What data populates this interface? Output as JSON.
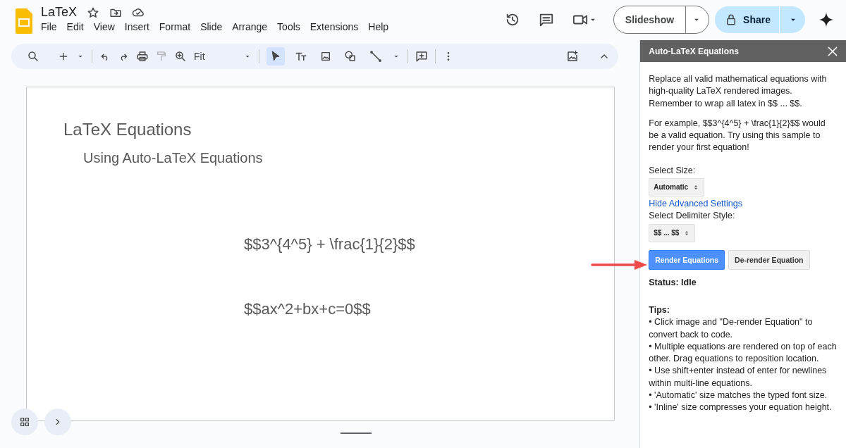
{
  "document": {
    "title": "LaTeX",
    "menu": [
      "File",
      "Edit",
      "View",
      "Insert",
      "Format",
      "Slide",
      "Arrange",
      "Tools",
      "Extensions",
      "Help"
    ]
  },
  "header_buttons": {
    "slideshow": "Slideshow",
    "share": "Share"
  },
  "toolbar": {
    "zoom": "Fit",
    "tools": [
      {
        "kind": "select",
        "selected": true
      },
      {
        "kind": "text",
        "selected": false
      },
      {
        "kind": "image",
        "selected": false
      },
      {
        "kind": "shape",
        "selected": false
      },
      {
        "kind": "line",
        "selected": false
      }
    ]
  },
  "slide": {
    "title": "LaTeX Equations",
    "subtitle": "Using Auto-LaTeX Equations",
    "equations": [
      "$$3^{4^5} + \\frac{1}{2}$$",
      "$$ax^2+bx+c=0$$"
    ]
  },
  "sidebar": {
    "title": "Auto-LaTeX Equations",
    "paragraphs": [
      "Replace all valid mathematical equations with high-quality LaTeX rendered images. Remember to wrap all latex in $$ ... $$.",
      "For example, $$3^{4^5} + \\frac{1}{2}$$ would be a valid equation. Try using this sample to render your first equation!"
    ],
    "size_label": "Select Size:",
    "size_value": "Automatic",
    "advanced_link": "Hide Advanced Settings",
    "delimiter_label": "Select Delimiter Style:",
    "delimiter_value": "$$ ... $$",
    "buttons": [
      {
        "label": "Render Equations",
        "kind": "primary"
      },
      {
        "label": "De-render Equation",
        "kind": "secondary"
      }
    ],
    "status": "Status: Idle",
    "tips_title": "Tips:",
    "tips": [
      "• Click image and \"De-render Equation\" to convert back to code.",
      "• Multiple equations are rendered on top of each other. Drag equations to reposition location.",
      "• Use shift+enter instead of enter for newlines within multi-line equations.",
      "• 'Automatic' size matches the typed font size.",
      "• 'Inline' size compresses your equation height."
    ]
  }
}
